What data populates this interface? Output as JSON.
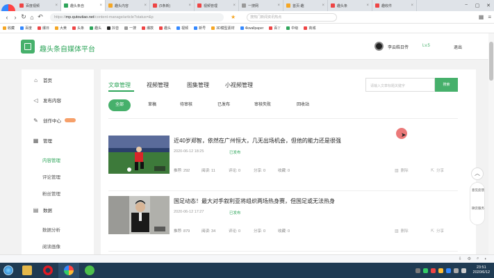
{
  "browser": {
    "tabs": [
      {
        "label": "百度视频",
        "color": "#e44"
      },
      {
        "label": "趣头条自",
        "color": "#2ea55a",
        "active": true
      },
      {
        "label": "趣头内容",
        "color": "#f5a623"
      },
      {
        "label": "(5条新)",
        "color": "#e44"
      },
      {
        "label": "视频管理",
        "color": "#e44"
      },
      {
        "label": "一搜网",
        "color": "#999"
      },
      {
        "label": "首页-趣",
        "color": "#f5a623"
      },
      {
        "label": "趣头条",
        "color": "#e44"
      },
      {
        "label": "趣收件",
        "color": "#e44"
      }
    ],
    "url_prefix": "https://",
    "url_host": "mp.qutoutiao.net",
    "url_path": "/content-manage/article?status=&p",
    "search_placeholder": "搜热门新闻资讯热点",
    "window_controls": [
      "−",
      "▢",
      "✕"
    ]
  },
  "bookmarks": [
    {
      "label": "收藏",
      "color": "#f5a623"
    },
    {
      "label": "百度",
      "color": "#38f"
    },
    {
      "label": "爆日",
      "color": "#e44"
    },
    {
      "label": "大黄",
      "color": "#f5a623"
    },
    {
      "label": "头条",
      "color": "#e44"
    },
    {
      "label": "趣头",
      "color": "#2ea55a"
    },
    {
      "label": "抖音",
      "color": "#222"
    },
    {
      "label": "一搜",
      "color": "#999"
    },
    {
      "label": "爆款",
      "color": "#e44"
    },
    {
      "label": "趣头",
      "color": "#e44"
    },
    {
      "label": "视频",
      "color": "#38f"
    },
    {
      "label": "新号",
      "color": "#38f"
    },
    {
      "label": "3D模型素材",
      "color": "#f5a623"
    },
    {
      "label": "4kwallpaper",
      "color": "#38f"
    },
    {
      "label": "百丫",
      "color": "#e44"
    },
    {
      "label": "中级",
      "color": "#2ea55a"
    },
    {
      "label": "商城",
      "color": "#e44"
    }
  ],
  "header": {
    "site_name": "趣头条自媒体平台",
    "user": "李云皓日传",
    "level": "Lv.5",
    "logout": "退出"
  },
  "sidebar": {
    "items": [
      {
        "label": "首页",
        "icon": "home-icon",
        "glyph": "⌂"
      },
      {
        "label": "发布内容",
        "icon": "send-icon",
        "glyph": "◁"
      },
      {
        "label": "创作中心",
        "icon": "pen-icon",
        "glyph": "✎"
      },
      {
        "label": "管理",
        "icon": "grid-icon",
        "glyph": "▦"
      },
      {
        "label": "数据",
        "icon": "chart-icon",
        "glyph": "▤"
      }
    ],
    "manage_sub": [
      "内容管理",
      "评论管理",
      "粉丝管理"
    ],
    "data_sub": [
      "数据分析",
      "阅读画像"
    ]
  },
  "main": {
    "tabs": [
      "文章管理",
      "视频管理",
      "图集管理",
      "小视频管理"
    ],
    "search_placeholder": "请输入文章标题关键字",
    "search_button": "搜索",
    "filters": [
      "全部",
      "草稿",
      "待审核",
      "已发布",
      "审核失败",
      "回收站"
    ],
    "articles": [
      {
        "title": "近40岁郑智，依然在广州恒大，几无出场机会，但他的能力还是很强",
        "time": "2020-06-12 18:25",
        "status": "已发布",
        "stats": [
          "推荐: 292",
          "阅读: 11",
          "评论: 0",
          "分享: 0",
          "收藏: 0"
        ],
        "delete": "删除",
        "share": "分享"
      },
      {
        "title": "国足动态！最大对手叙利亚将组织两场热身赛，但国足或无法热身",
        "time": "2020-06-12 17:27",
        "status": "已发布",
        "stats": [
          "推荐: 879",
          "阅读: 34",
          "评论: 0",
          "分享: 0",
          "收藏: 0"
        ],
        "delete": "删除",
        "share": "分享"
      }
    ]
  },
  "float": {
    "up": "︿",
    "label1": "意见反馈",
    "label2": "微云服务"
  },
  "taskbar": {
    "time": "23:51",
    "date": "2020/6/12"
  }
}
